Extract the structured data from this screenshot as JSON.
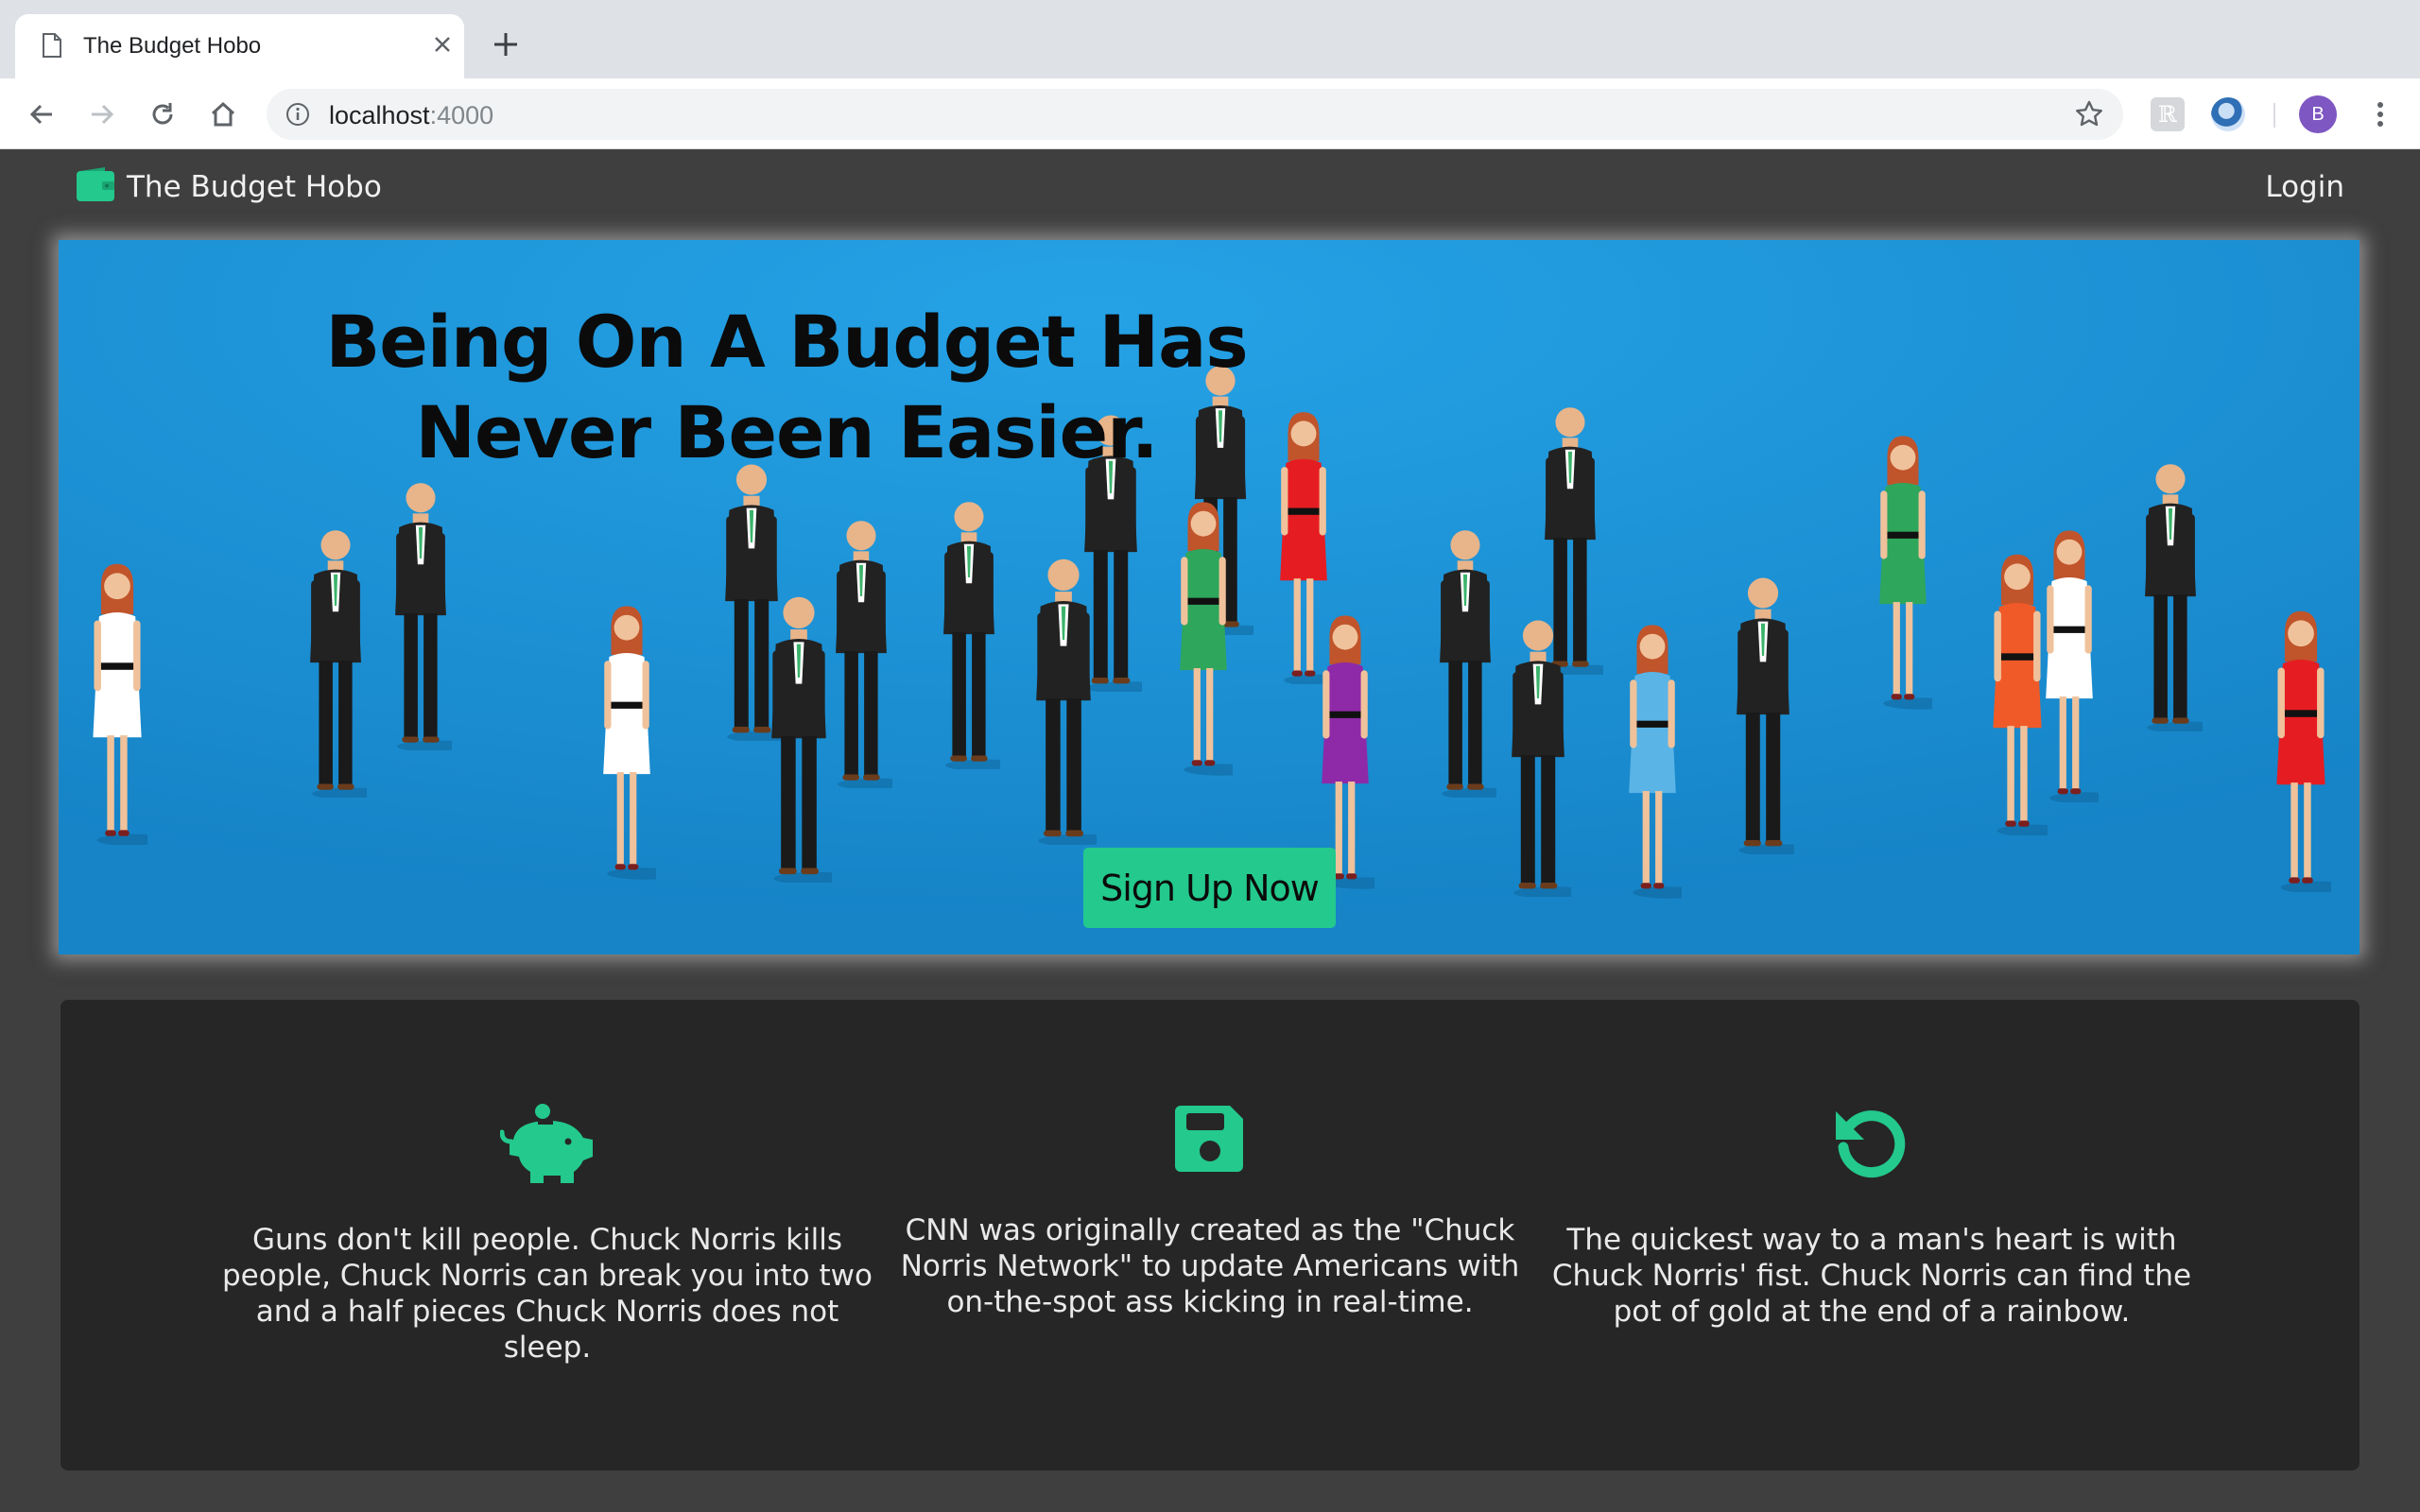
{
  "browser": {
    "tab_title": "The Budget Hobo",
    "url_host": "localhost",
    "url_port": ":4000",
    "avatar_letter": "B",
    "extension_letter": "ℝ"
  },
  "nav": {
    "brand": "The Budget Hobo",
    "login": "Login"
  },
  "hero": {
    "title_line1": "Being On A Budget Has",
    "title_line2": "Never Been Easier.",
    "cta": "Sign Up Now"
  },
  "features": [
    {
      "icon": "piggy-bank-icon",
      "text": "Guns don't kill people. Chuck Norris kills people, Chuck Norris can break you into two and a half pieces Chuck Norris does not sleep."
    },
    {
      "icon": "floppy-disk-icon",
      "text": "CNN was originally created as the \"Chuck Norris Network\" to update Americans with on-the-spot ass kicking in real-time."
    },
    {
      "icon": "undo-icon",
      "text": "The quickest way to a man's heart is with Chuck Norris' fist. Chuck Norris can find the pot of gold at the end of a rainbow."
    }
  ],
  "colors": {
    "accent": "#23c98d",
    "hero_bg": "#1a8fd4",
    "nav_bg": "#3f3f3f",
    "panel_bg": "#262626"
  }
}
